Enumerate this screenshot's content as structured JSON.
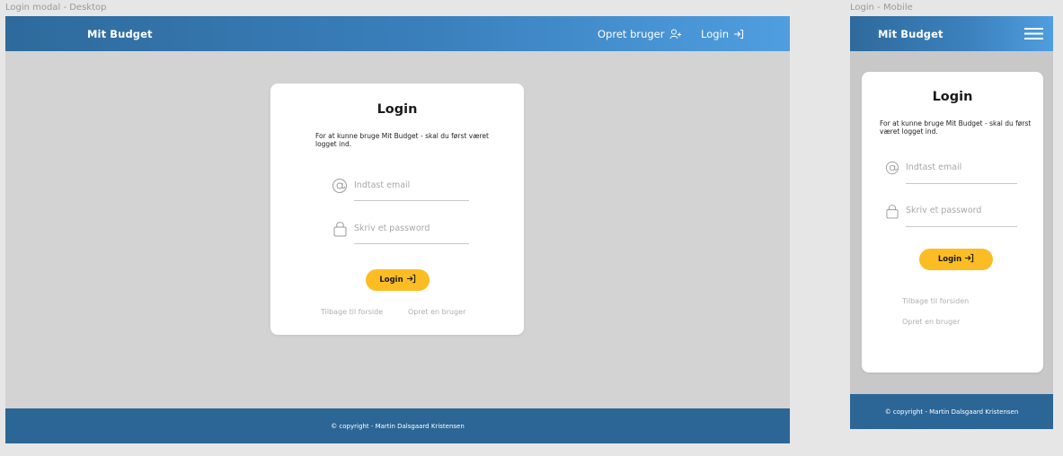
{
  "desktop": {
    "frame_label": "Login modal - Desktop",
    "header": {
      "brand": "Mit Budget",
      "create_user_label": "Opret bruger",
      "login_label": "Login",
      "colors": {
        "from": "#2e6a9c",
        "to": "#4f9ee0"
      }
    },
    "modal": {
      "title": "Login",
      "description": "For at kunne bruge Mit Budget - skal du først været logget ind.",
      "email_placeholder": "Indtast email",
      "password_placeholder": "Skriv et password",
      "login_button": "Login",
      "back_link": "Tilbage til forside",
      "create_link": "Opret en bruger"
    },
    "footer": {
      "text": "© copyright - Martin Dalsgaard Kristensen"
    }
  },
  "mobile": {
    "frame_label": "Login - Mobile",
    "header": {
      "brand": "Mit Budget"
    },
    "modal": {
      "title": "Login",
      "description": "For at kunne bruge Mit Budget - skal du først været logget ind.",
      "email_placeholder": "Indtast email",
      "password_placeholder": "Skriv et password",
      "login_button": "Login",
      "back_link": "Tilbage til forsiden",
      "create_link": "Opret en bruger"
    },
    "footer": {
      "text": "© copyright - Martin Dalsgaard Kristensen"
    }
  },
  "colors": {
    "accent_button": "#fbbd23",
    "footer": "#2c6696",
    "page_bg": "#d3d3d3"
  },
  "icons": {
    "user_plus": "user-plus-icon",
    "login": "login-arrow-icon",
    "email": "at-icon",
    "password": "lock-icon",
    "menu": "hamburger-menu-icon"
  }
}
